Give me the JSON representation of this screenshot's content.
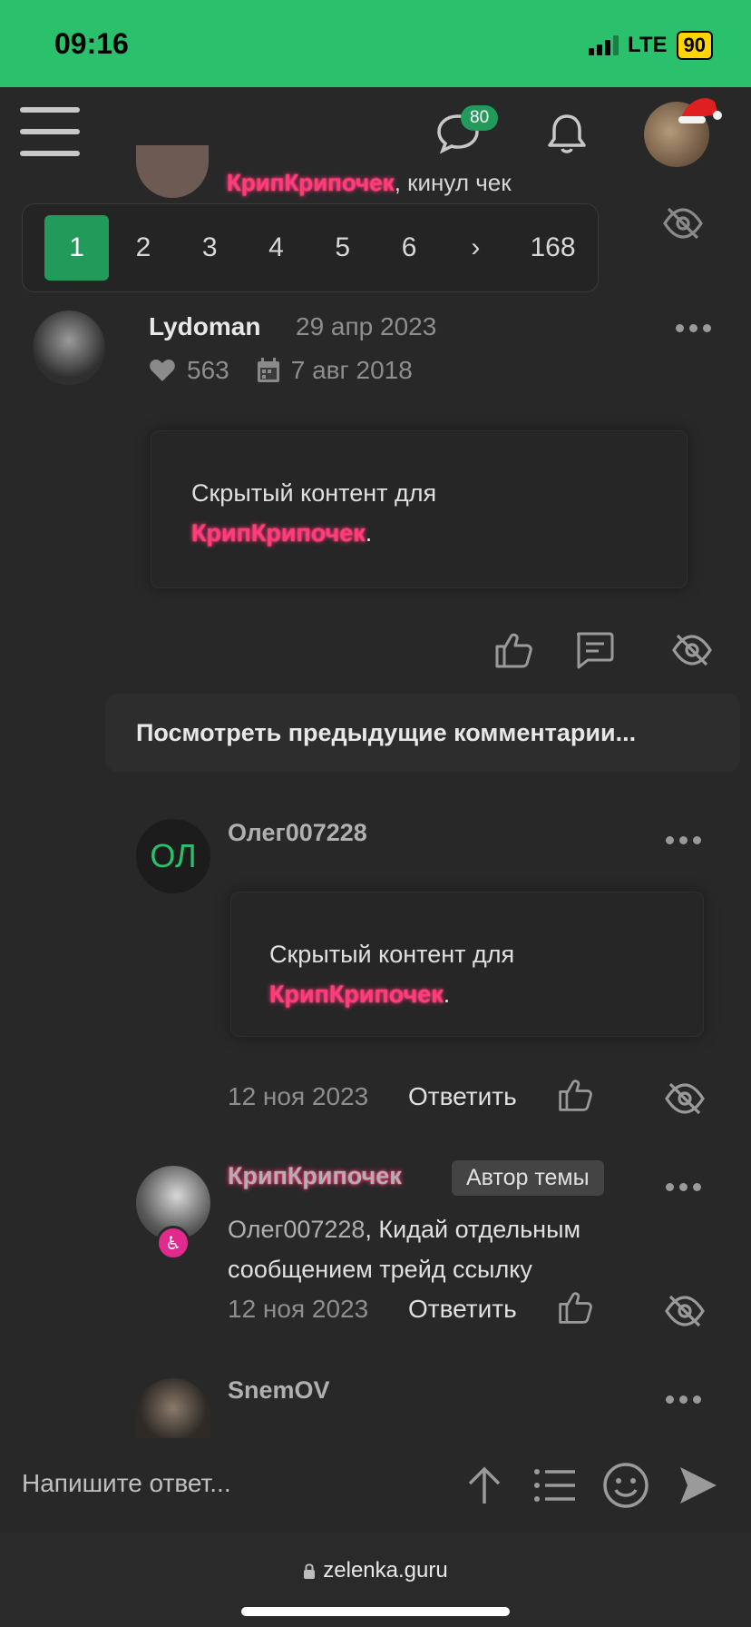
{
  "status_bar": {
    "time": "09:16",
    "network": "LTE",
    "battery": "90"
  },
  "header": {
    "messages_count": "80"
  },
  "previous_comment": {
    "author": "КрипКрипочек",
    "text": ", кинул чек"
  },
  "pagination": {
    "pages": [
      "1",
      "2",
      "3",
      "4",
      "5",
      "6"
    ],
    "next": "›",
    "last": "168",
    "active": "1"
  },
  "post": {
    "author": "Lydoman",
    "date": "29 апр 2023",
    "likes": "563",
    "registered": "7 авг 2018",
    "hidden_text": "Скрытый контент для",
    "hidden_user": "КрипКрипочек",
    "hidden_end": "."
  },
  "more_comments": "Посмотреть предыдущие комментарии...",
  "comments": [
    {
      "author": "Олег007228",
      "avatar_initials": "ОЛ",
      "hidden_text": "Скрытый контент для",
      "hidden_user": "КрипКрипочек",
      "hidden_end": ".",
      "date": "12 ноя 2023",
      "reply": "Ответить"
    },
    {
      "author": "КрипКрипочек",
      "badge": "Автор темы",
      "mention": "Олег007228",
      "text": ", Кидай отдельным сообщением трейд ссылку",
      "date": "12 ноя 2023",
      "reply": "Ответить"
    },
    {
      "author": "SnemOV"
    }
  ],
  "reply_bar": {
    "placeholder": "Напишите ответ..."
  },
  "browser": {
    "url": "zelenka.guru"
  },
  "colors": {
    "accent": "#229a5a",
    "status_bar": "#2bc06b",
    "background": "#282828",
    "highlight_name": "#ff3d7a"
  }
}
